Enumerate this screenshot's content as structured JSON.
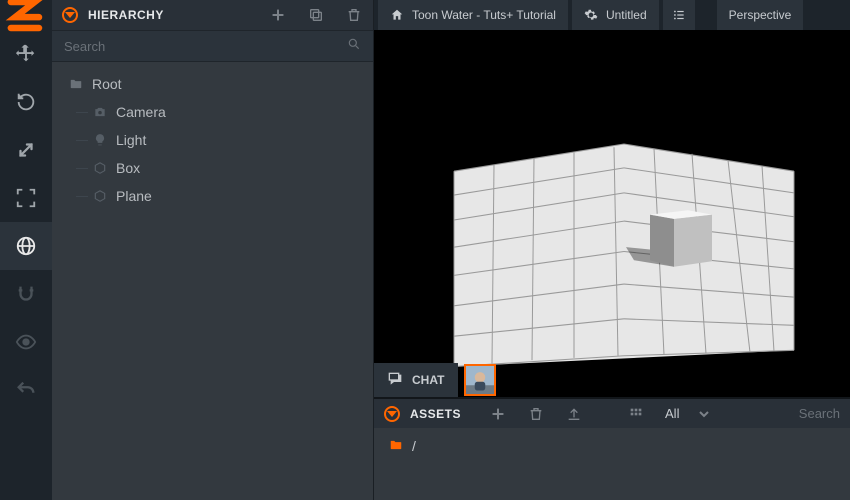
{
  "hierarchy": {
    "title": "HIERARCHY",
    "search_placeholder": "Search",
    "nodes": {
      "root": "Root",
      "camera": "Camera",
      "light": "Light",
      "box": "Box",
      "plane": "Plane"
    }
  },
  "topbar": {
    "project": "Toon Water - Tuts+ Tutorial",
    "scene": "Untitled",
    "camera_mode": "Perspective"
  },
  "chat": {
    "label": "CHAT"
  },
  "assets": {
    "title": "ASSETS",
    "filter": "All",
    "search_placeholder": "Search",
    "breadcrumb": "/"
  }
}
